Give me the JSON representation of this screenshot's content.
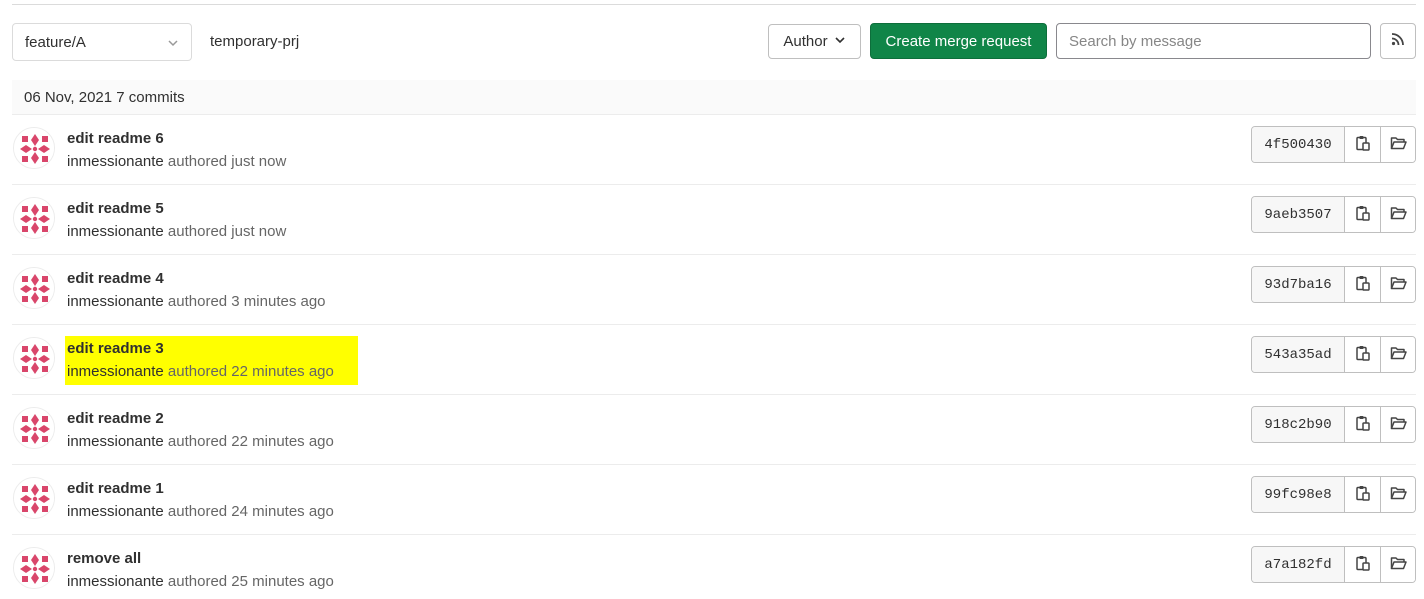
{
  "toolbar": {
    "branch": "feature/A",
    "project": "temporary-prj",
    "author_label": "Author",
    "create_mr_label": "Create merge request",
    "search_placeholder": "Search by message"
  },
  "day_header": "06 Nov, 2021 7 commits",
  "colors": {
    "primary_green": "#108548",
    "highlight": "#ffff00",
    "avatar": "#d9466b"
  },
  "commits": [
    {
      "title": "edit readme 6",
      "author": "inmessionante",
      "verb": "authored",
      "time": "just now",
      "sha": "4f500430",
      "highlighted": false
    },
    {
      "title": "edit readme 5",
      "author": "inmessionante",
      "verb": "authored",
      "time": "just now",
      "sha": "9aeb3507",
      "highlighted": false
    },
    {
      "title": "edit readme 4",
      "author": "inmessionante",
      "verb": "authored",
      "time": "3 minutes ago",
      "sha": "93d7ba16",
      "highlighted": false
    },
    {
      "title": "edit readme 3",
      "author": "inmessionante",
      "verb": "authored",
      "time": "22 minutes ago",
      "sha": "543a35ad",
      "highlighted": true
    },
    {
      "title": "edit readme 2",
      "author": "inmessionante",
      "verb": "authored",
      "time": "22 minutes ago",
      "sha": "918c2b90",
      "highlighted": false
    },
    {
      "title": "edit readme 1",
      "author": "inmessionante",
      "verb": "authored",
      "time": "24 minutes ago",
      "sha": "99fc98e8",
      "highlighted": false
    },
    {
      "title": "remove all",
      "author": "inmessionante",
      "verb": "authored",
      "time": "25 minutes ago",
      "sha": "a7a182fd",
      "highlighted": false
    }
  ]
}
